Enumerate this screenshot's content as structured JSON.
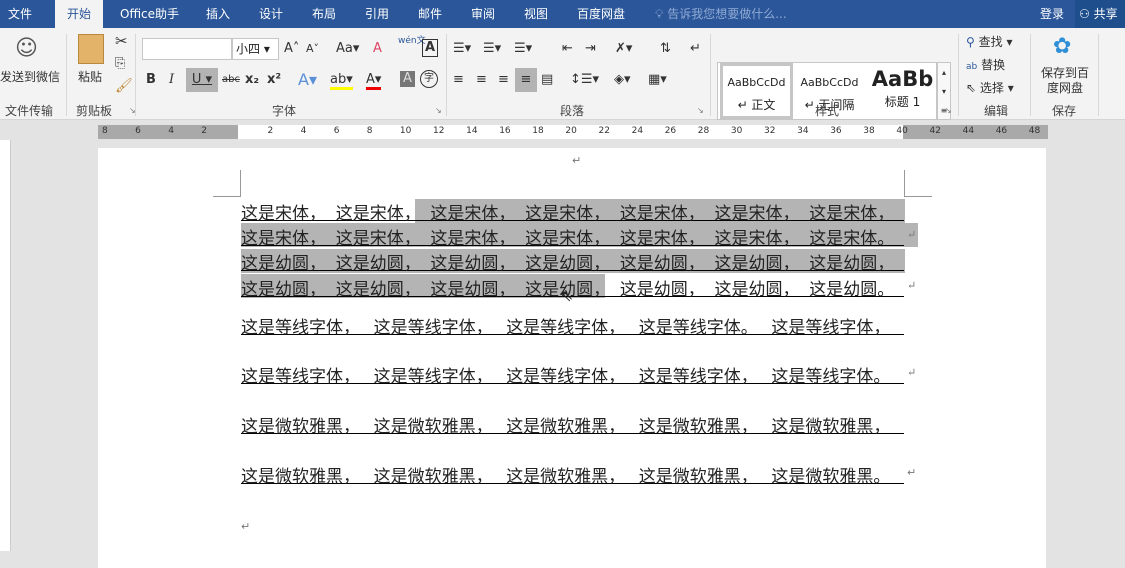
{
  "tabs": [
    "文件",
    "开始",
    "Office助手",
    "插入",
    "设计",
    "布局",
    "引用",
    "邮件",
    "审阅",
    "视图",
    "百度网盘"
  ],
  "tell_me": "告诉我您想要做什么...",
  "login": "登录",
  "share": "共享",
  "ribbon": {
    "send_wechat": "发送到微信",
    "group_file_transfer": "文件传输",
    "paste": "粘贴",
    "group_clipboard": "剪贴板",
    "font_name": "",
    "font_size": "小四",
    "change_case": "Aa",
    "phonetic": "wén文",
    "group_font": "字体",
    "bold": "B",
    "italic": "I",
    "underline": "U",
    "strike": "abc",
    "sub": "x₂",
    "sup": "x²",
    "group_paragraph": "段落",
    "styles": [
      {
        "preview": "AaBbCcDd",
        "name": "↵ 正文"
      },
      {
        "preview": "AaBbCcDd",
        "name": "↵ 无间隔"
      },
      {
        "preview": "AaBb",
        "name": "标题 1"
      }
    ],
    "group_styles": "样式",
    "find": "查找",
    "replace": "替换",
    "select": "选择",
    "group_edit": "编辑",
    "save_baidu": "保存到百度网盘",
    "group_save": "保存"
  },
  "ruler": [
    "8",
    "6",
    "4",
    "2",
    "",
    "2",
    "4",
    "6",
    "8",
    "10",
    "12",
    "14",
    "16",
    "18",
    "20",
    "22",
    "24",
    "26",
    "28",
    "30",
    "32",
    "34",
    "36",
    "38",
    "40",
    "42",
    "44",
    "46",
    "48"
  ],
  "header_mark": "↵",
  "doc_lines": [
    {
      "segs": [
        "这是宋体，",
        "这是宋体，",
        "这是宋体，",
        "这是宋体，",
        "这是宋体，",
        "这是宋体，",
        "这是宋体，"
      ],
      "end": ""
    },
    {
      "segs": [
        "这是宋体，",
        "这是宋体，",
        "这是宋体，",
        "这是宋体，",
        "这是宋体，",
        "这是宋体，",
        "这是宋体。"
      ],
      "end": "↵"
    },
    {
      "segs": [
        "这是幼圆，",
        "这是幼圆，",
        "这是幼圆，",
        "这是幼圆，",
        "这是幼圆，",
        "这是幼圆，",
        "这是幼圆，"
      ],
      "end": ""
    },
    {
      "segs": [
        "这是幼圆，",
        "这是幼圆，",
        "这是幼圆，",
        "这是幼圆，",
        "这是幼圆，",
        "这是幼圆，",
        "这是幼圆。"
      ],
      "end": "↵"
    },
    {
      "segs": [
        "这是等线字体，",
        "这是等线字体，",
        "这是等线字体，",
        "这是等线字体。",
        "这是等线字体，"
      ],
      "end": ""
    },
    {
      "segs": [
        "这是等线字体，",
        "这是等线字体，",
        "这是等线字体，",
        "这是等线字体，",
        "这是等线字体。"
      ],
      "end": "↵"
    },
    {
      "segs": [
        "这是微软雅黑，",
        "这是微软雅黑，",
        "这是微软雅黑，",
        "这是微软雅黑，",
        "这是微软雅黑，"
      ],
      "end": ""
    },
    {
      "segs": [
        "这是微软雅黑，",
        "这是微软雅黑，",
        "这是微软雅黑，",
        "这是微软雅黑，",
        "这是微软雅黑。"
      ],
      "end": "↵"
    }
  ],
  "empty_para": "↵"
}
